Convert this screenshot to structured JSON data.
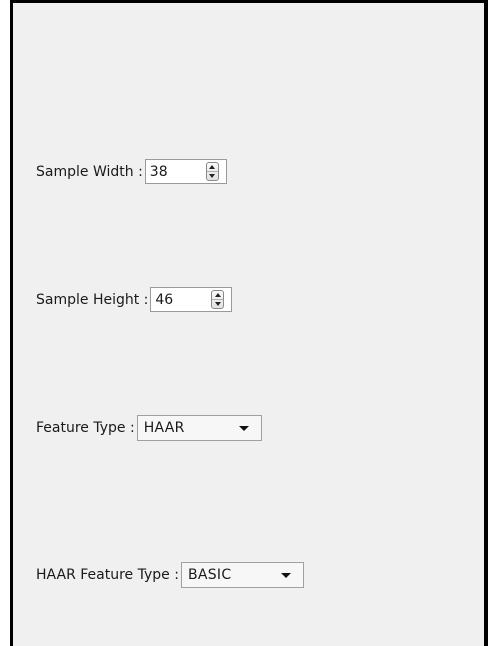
{
  "form": {
    "sample_width": {
      "label": "Sample Width :",
      "value": "38"
    },
    "sample_height": {
      "label": "Sample Height :",
      "value": "46"
    },
    "feature_type": {
      "label": "Feature Type :",
      "value": "HAAR"
    },
    "haar_feature_type": {
      "label": "HAAR Feature Type :",
      "value": "BASIC"
    }
  },
  "icons": {
    "spin_up": "chevron-up-icon",
    "spin_down": "chevron-down-icon",
    "dropdown": "dropdown-arrow-icon"
  }
}
